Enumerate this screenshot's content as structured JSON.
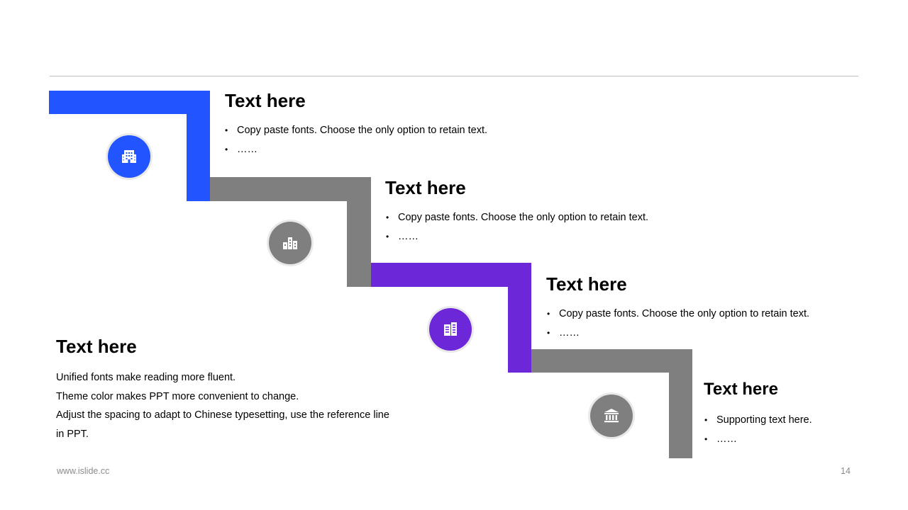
{
  "colors": {
    "blue": "#2255FF",
    "gray": "#7F7F7F",
    "purple": "#6C27D9",
    "divider": "#BFBFBF"
  },
  "steps": [
    {
      "title": "Text here",
      "bullets": [
        "Copy paste fonts. Choose the only option to retain text.",
        "……"
      ],
      "icon": "office-building-icon"
    },
    {
      "title": "Text here",
      "bullets": [
        "Copy paste fonts. Choose the only option to retain text.",
        "……"
      ],
      "icon": "city-buildings-icon"
    },
    {
      "title": "Text here",
      "bullets": [
        "Copy paste fonts. Choose the only option to retain text.",
        "……"
      ],
      "icon": "apartment-building-icon"
    },
    {
      "title": "Text here",
      "bullets": [
        "Supporting text here.",
        "……"
      ],
      "icon": "bank-icon"
    }
  ],
  "summary": {
    "title": "Text here",
    "lines": [
      "Unified fonts make reading more fluent.",
      "Theme color makes PPT more convenient to change.",
      "Adjust the spacing to adapt to Chinese typesetting, use the reference line in PPT."
    ]
  },
  "footer": {
    "website": "www.islide.cc",
    "page_number": "14"
  }
}
